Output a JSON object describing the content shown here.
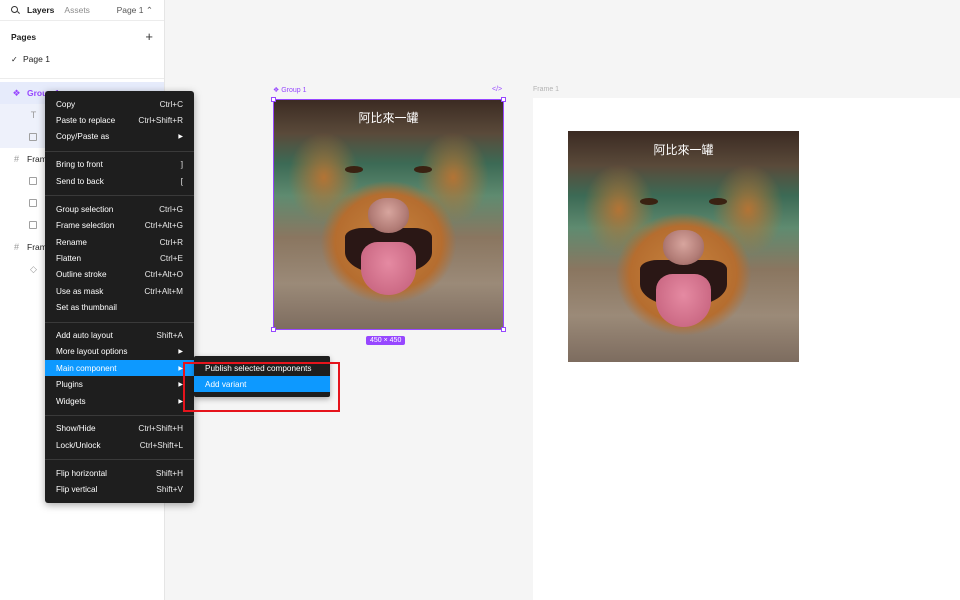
{
  "left_panel": {
    "tabs": {
      "layers": "Layers",
      "assets": "Assets"
    },
    "page_selector": "Page 1 ⌃",
    "pages_label": "Pages",
    "page_items": [
      {
        "label": "Page 1",
        "check": "✓"
      }
    ],
    "layers": [
      {
        "label": "Group 1",
        "icon": "component-icon"
      },
      {
        "label": "",
        "icon": "text-icon"
      },
      {
        "label": "",
        "icon": "image-icon"
      },
      {
        "label": "Frame",
        "icon": "frame-icon"
      },
      {
        "label": "",
        "icon": "image-icon"
      },
      {
        "label": "",
        "icon": "image-icon"
      },
      {
        "label": "",
        "icon": "image-icon"
      },
      {
        "label": "Frame",
        "icon": "frame-icon"
      },
      {
        "label": "",
        "icon": "diamond-icon"
      }
    ]
  },
  "canvas": {
    "group_label": "❖ Group 1",
    "code_icon": "</>",
    "frame_label": "Frame 1",
    "image_caption": "阿比來一罐",
    "size_badge": "450 × 450"
  },
  "context_menu": {
    "items": [
      {
        "label": "Copy",
        "shortcut": "Ctrl+C"
      },
      {
        "label": "Paste to replace",
        "shortcut": "Ctrl+Shift+R"
      },
      {
        "label": "Copy/Paste as",
        "shortcut": "▶"
      },
      {
        "label": "Bring to front",
        "shortcut": "]"
      },
      {
        "label": "Send to back",
        "shortcut": "["
      },
      {
        "label": "Group selection",
        "shortcut": "Ctrl+G"
      },
      {
        "label": "Frame selection",
        "shortcut": "Ctrl+Alt+G"
      },
      {
        "label": "Rename",
        "shortcut": "Ctrl+R"
      },
      {
        "label": "Flatten",
        "shortcut": "Ctrl+E"
      },
      {
        "label": "Outline stroke",
        "shortcut": "Ctrl+Alt+O"
      },
      {
        "label": "Use as mask",
        "shortcut": "Ctrl+Alt+M"
      },
      {
        "label": "Set as thumbnail",
        "shortcut": ""
      },
      {
        "label": "Add auto layout",
        "shortcut": "Shift+A"
      },
      {
        "label": "More layout options",
        "shortcut": "▶"
      },
      {
        "label": "Main component",
        "shortcut": "▶"
      },
      {
        "label": "Plugins",
        "shortcut": "▶"
      },
      {
        "label": "Widgets",
        "shortcut": "▶"
      },
      {
        "label": "Show/Hide",
        "shortcut": "Ctrl+Shift+H"
      },
      {
        "label": "Lock/Unlock",
        "shortcut": "Ctrl+Shift+L"
      },
      {
        "label": "Flip horizontal",
        "shortcut": "Shift+H"
      },
      {
        "label": "Flip vertical",
        "shortcut": "Shift+V"
      }
    ]
  },
  "submenu": {
    "items": [
      {
        "label": "Publish selected components"
      },
      {
        "label": "Add variant"
      }
    ]
  },
  "colors": {
    "accent_purple": "#9747ff",
    "menu_bg": "#1e1e1e",
    "menu_active": "#0d99ff",
    "highlight_red": "#e5141c"
  }
}
